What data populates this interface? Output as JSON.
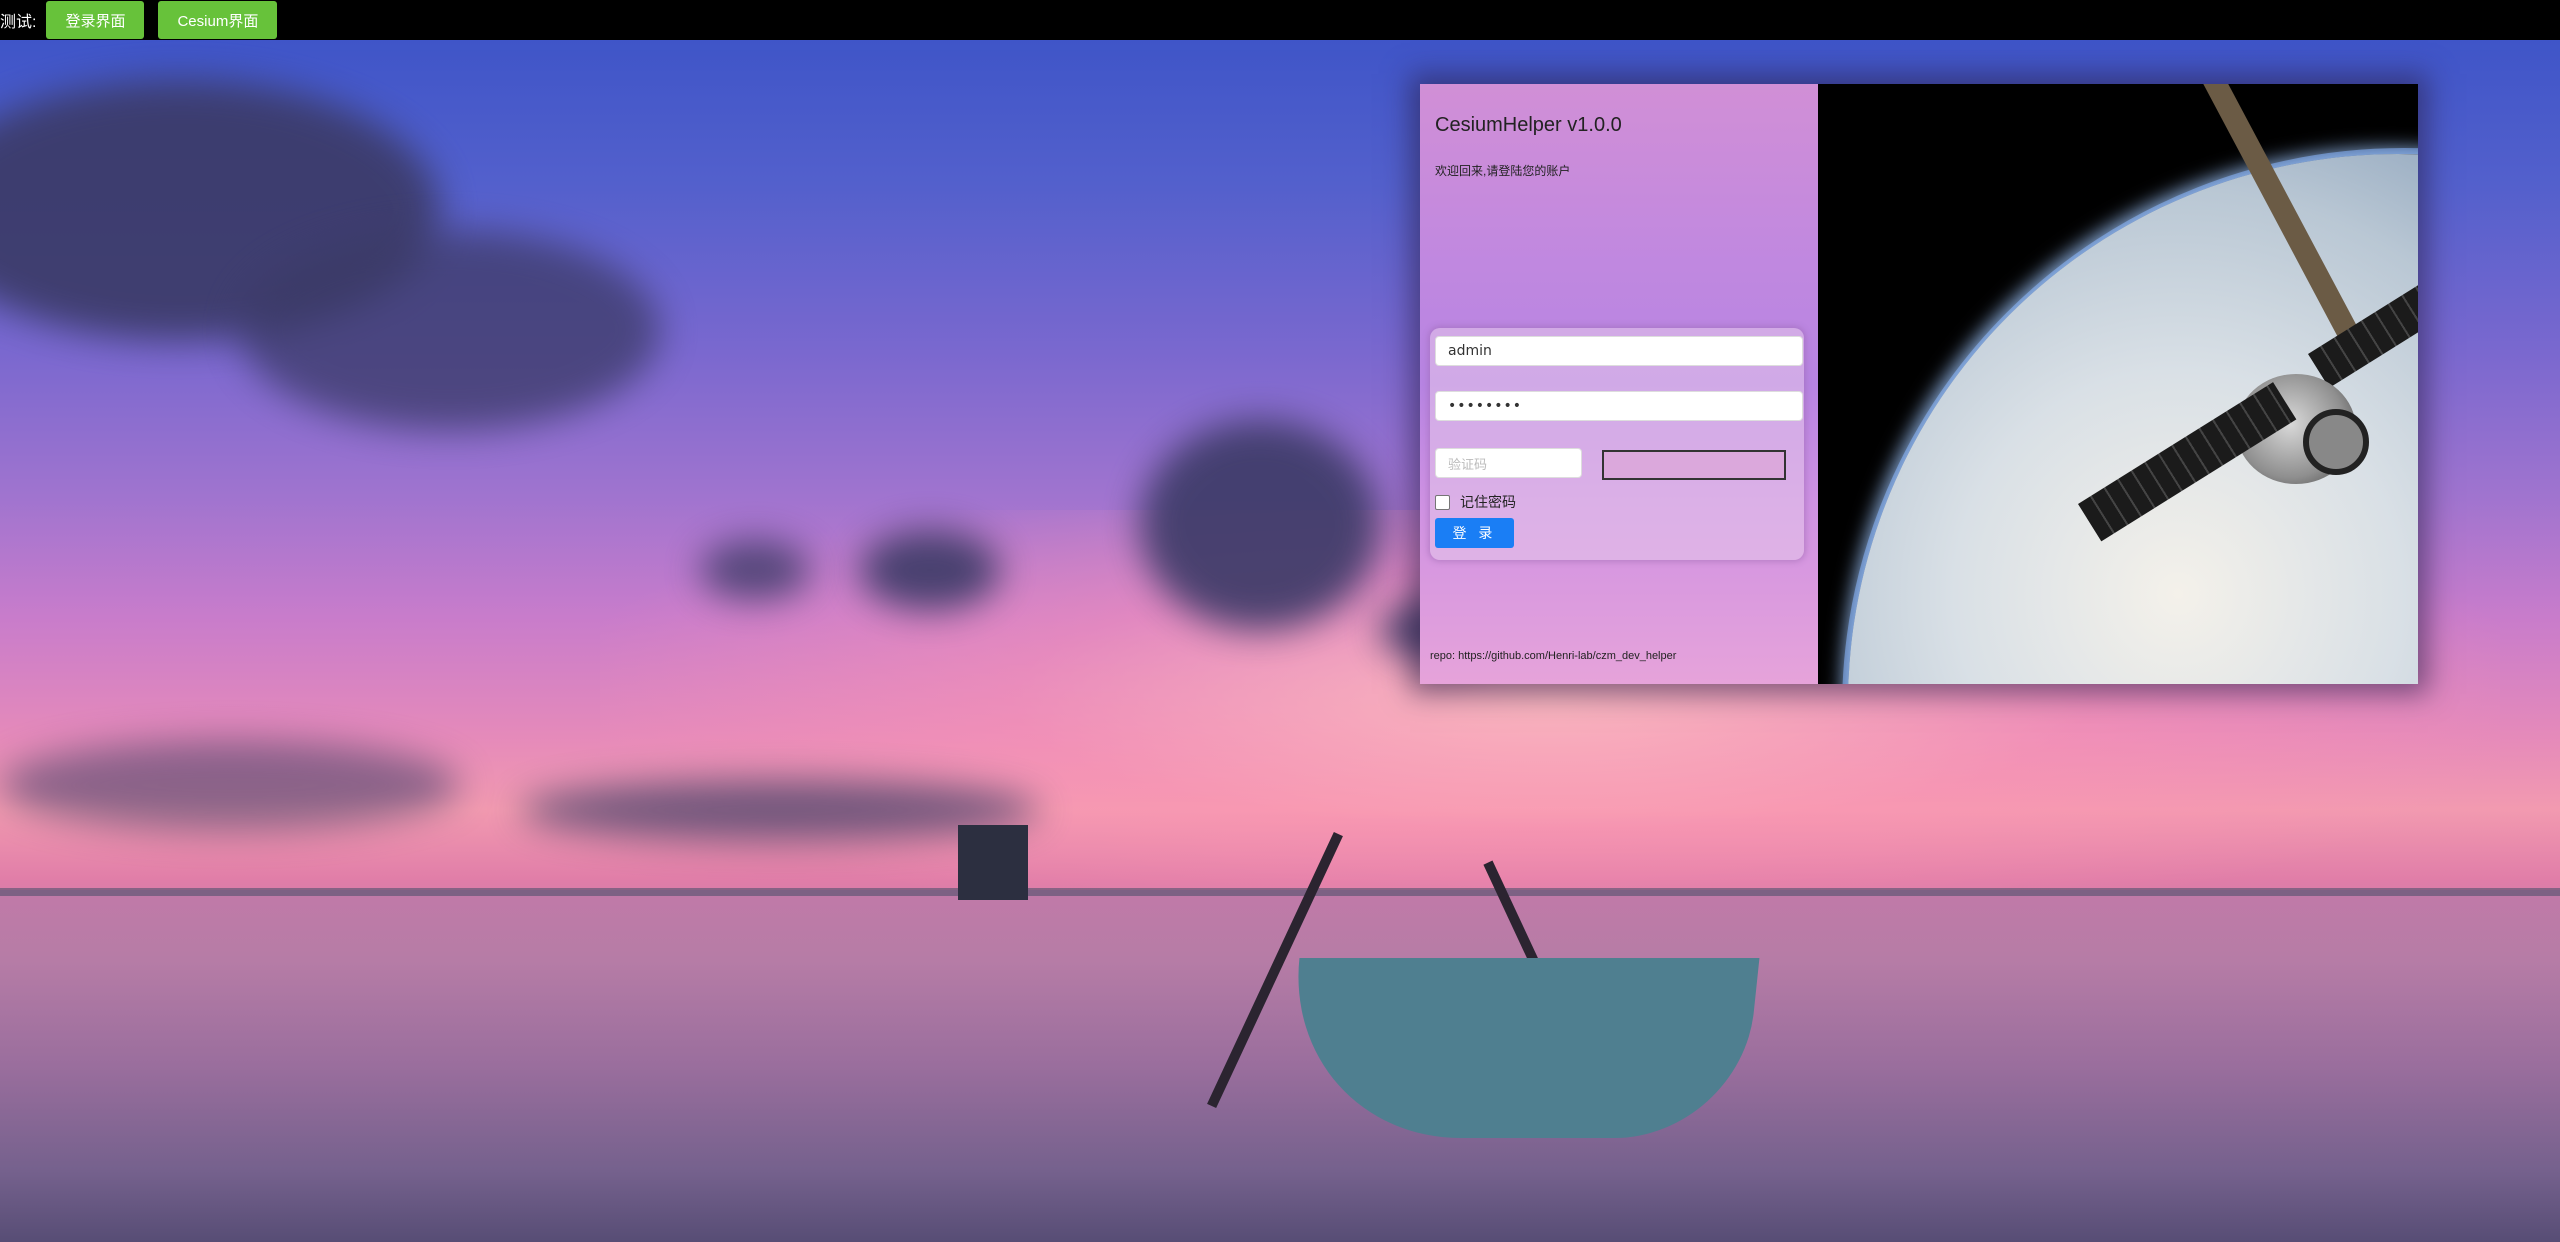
{
  "topbar": {
    "label": "测试:",
    "buttons": [
      {
        "label": "登录界面"
      },
      {
        "label": "Cesium界面"
      }
    ],
    "button_color": "#67c23a"
  },
  "login": {
    "title": "CesiumHelper v1.0.0",
    "welcome": "欢迎回来,请登陆您的账户",
    "username_value": "admin",
    "password_value": "••••••••",
    "captcha_placeholder": "验证码",
    "remember_label": "记住密码",
    "remember_checked": false,
    "submit_label": "登 录",
    "submit_color": "#1a7ef5",
    "repo": "repo: https://github.com/Henri-lab/czm_dev_helper"
  }
}
